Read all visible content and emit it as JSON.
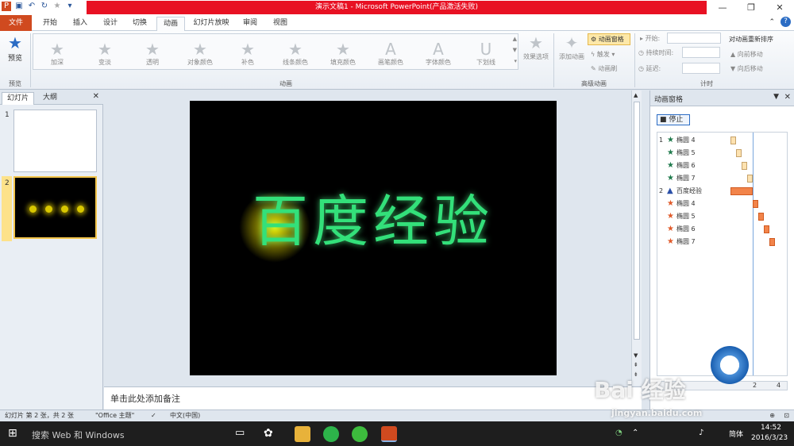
{
  "window": {
    "title": "演示文稿1 - Microsoft PowerPoint(产品激活失败)"
  },
  "tabs": [
    "文件",
    "开始",
    "插入",
    "设计",
    "切换",
    "动画",
    "幻灯片放映",
    "审阅",
    "视图"
  ],
  "ribbon": {
    "preview": "预览",
    "preview_group": "预览",
    "effects": [
      "加深",
      "变淡",
      "透明",
      "对象颜色",
      "补色",
      "线条颜色",
      "填充颜色",
      "画笔颜色",
      "字体颜色",
      "下划线"
    ],
    "effect_options": "效果选项",
    "anim_group": "动画",
    "add_animation": "添加动画",
    "anim_pane": "动画窗格",
    "trigger": "触发",
    "anim_painter": "动画刷",
    "adv_group": "高级动画",
    "start": "开始:",
    "duration": "持续时间:",
    "delay": "延迟:",
    "reorder": "对动画重新排序",
    "move_earlier": "向前移动",
    "move_later": "向后移动",
    "timing_group": "计时"
  },
  "left": {
    "tab_slides": "幻灯片",
    "tab_outline": "大纲",
    "slide1": "1",
    "slide2": "2"
  },
  "slide": {
    "text": "百度经验"
  },
  "notes": "单击此处添加备注",
  "pane": {
    "title": "动画窗格",
    "stop": "停止",
    "rows": [
      {
        "n": "1",
        "label": "椭圆 4",
        "kind": "g"
      },
      {
        "n": "",
        "label": "椭圆 5",
        "kind": "g"
      },
      {
        "n": "",
        "label": "椭圆 6",
        "kind": "g"
      },
      {
        "n": "",
        "label": "椭圆 7",
        "kind": "g"
      },
      {
        "n": "2",
        "label": "百度经验",
        "kind": "t"
      },
      {
        "n": "",
        "label": "椭圆 4",
        "kind": "o"
      },
      {
        "n": "",
        "label": "椭圆 5",
        "kind": "o"
      },
      {
        "n": "",
        "label": "椭圆 6",
        "kind": "o"
      },
      {
        "n": "",
        "label": "椭圆 7",
        "kind": "o"
      }
    ],
    "seconds": [
      "2",
      "4"
    ]
  },
  "status": {
    "slide": "幻灯片 第 2 张，共 2 张",
    "theme": "\"Office 主题\"",
    "lang": "中文(中国)"
  },
  "taskbar": {
    "search": "搜索 Web 和 Windows",
    "time": "14:52",
    "date": "2016/3/23",
    "ime": "简体"
  },
  "watermark": {
    "text": "Bai 经验",
    "url": "jingyan.baidu.com"
  }
}
